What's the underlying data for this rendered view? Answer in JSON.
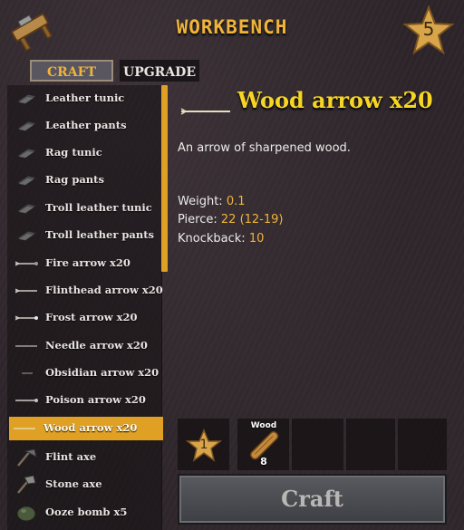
{
  "header": {
    "title": "WORKBENCH",
    "level": "5",
    "icon": "workbench-icon"
  },
  "tabs": [
    {
      "label": "CRAFT",
      "active": true
    },
    {
      "label": "UPGRADE",
      "active": false
    }
  ],
  "recipes": [
    {
      "label": "Leather tunic",
      "icon": "armor-icon"
    },
    {
      "label": "Leather pants",
      "icon": "armor-icon"
    },
    {
      "label": "Rag tunic",
      "icon": "armor-icon"
    },
    {
      "label": "Rag pants",
      "icon": "armor-icon"
    },
    {
      "label": "Troll leather tunic",
      "icon": "armor-icon"
    },
    {
      "label": "Troll leather pants",
      "icon": "armor-icon"
    },
    {
      "label": "Fire arrow x20",
      "icon": "arrow-icon"
    },
    {
      "label": "Flinthead arrow x20",
      "icon": "arrow-icon"
    },
    {
      "label": "Frost arrow x20",
      "icon": "arrow-icon"
    },
    {
      "label": "Needle arrow x20",
      "icon": "arrow-icon"
    },
    {
      "label": "Obsidian arrow x20",
      "icon": "arrow-icon"
    },
    {
      "label": "Poison arrow x20",
      "icon": "arrow-icon"
    },
    {
      "label": "Wood arrow x20",
      "icon": "arrow-icon",
      "selected": true
    },
    {
      "label": "Flint axe",
      "icon": "axe-icon"
    },
    {
      "label": "Stone axe",
      "icon": "axe-icon"
    },
    {
      "label": "Ooze bomb x5",
      "icon": "bomb-icon"
    }
  ],
  "detail": {
    "title": "Wood arrow x20",
    "description": "An arrow of sharpened wood.",
    "stats": [
      {
        "label": "Weight: ",
        "value": "0.1"
      },
      {
        "label": "Pierce: ",
        "value": "22 (12-19)"
      },
      {
        "label": "Knockback: ",
        "value": "10"
      }
    ]
  },
  "requirements": {
    "station_level": "1",
    "resources": [
      {
        "name": "Wood",
        "count": "8",
        "icon": "wood-icon"
      }
    ]
  },
  "craft_button": {
    "label": "Craft"
  },
  "colors": {
    "accent": "#f0b43a",
    "title": "#f7d623",
    "selected_row": "#e0a023"
  }
}
